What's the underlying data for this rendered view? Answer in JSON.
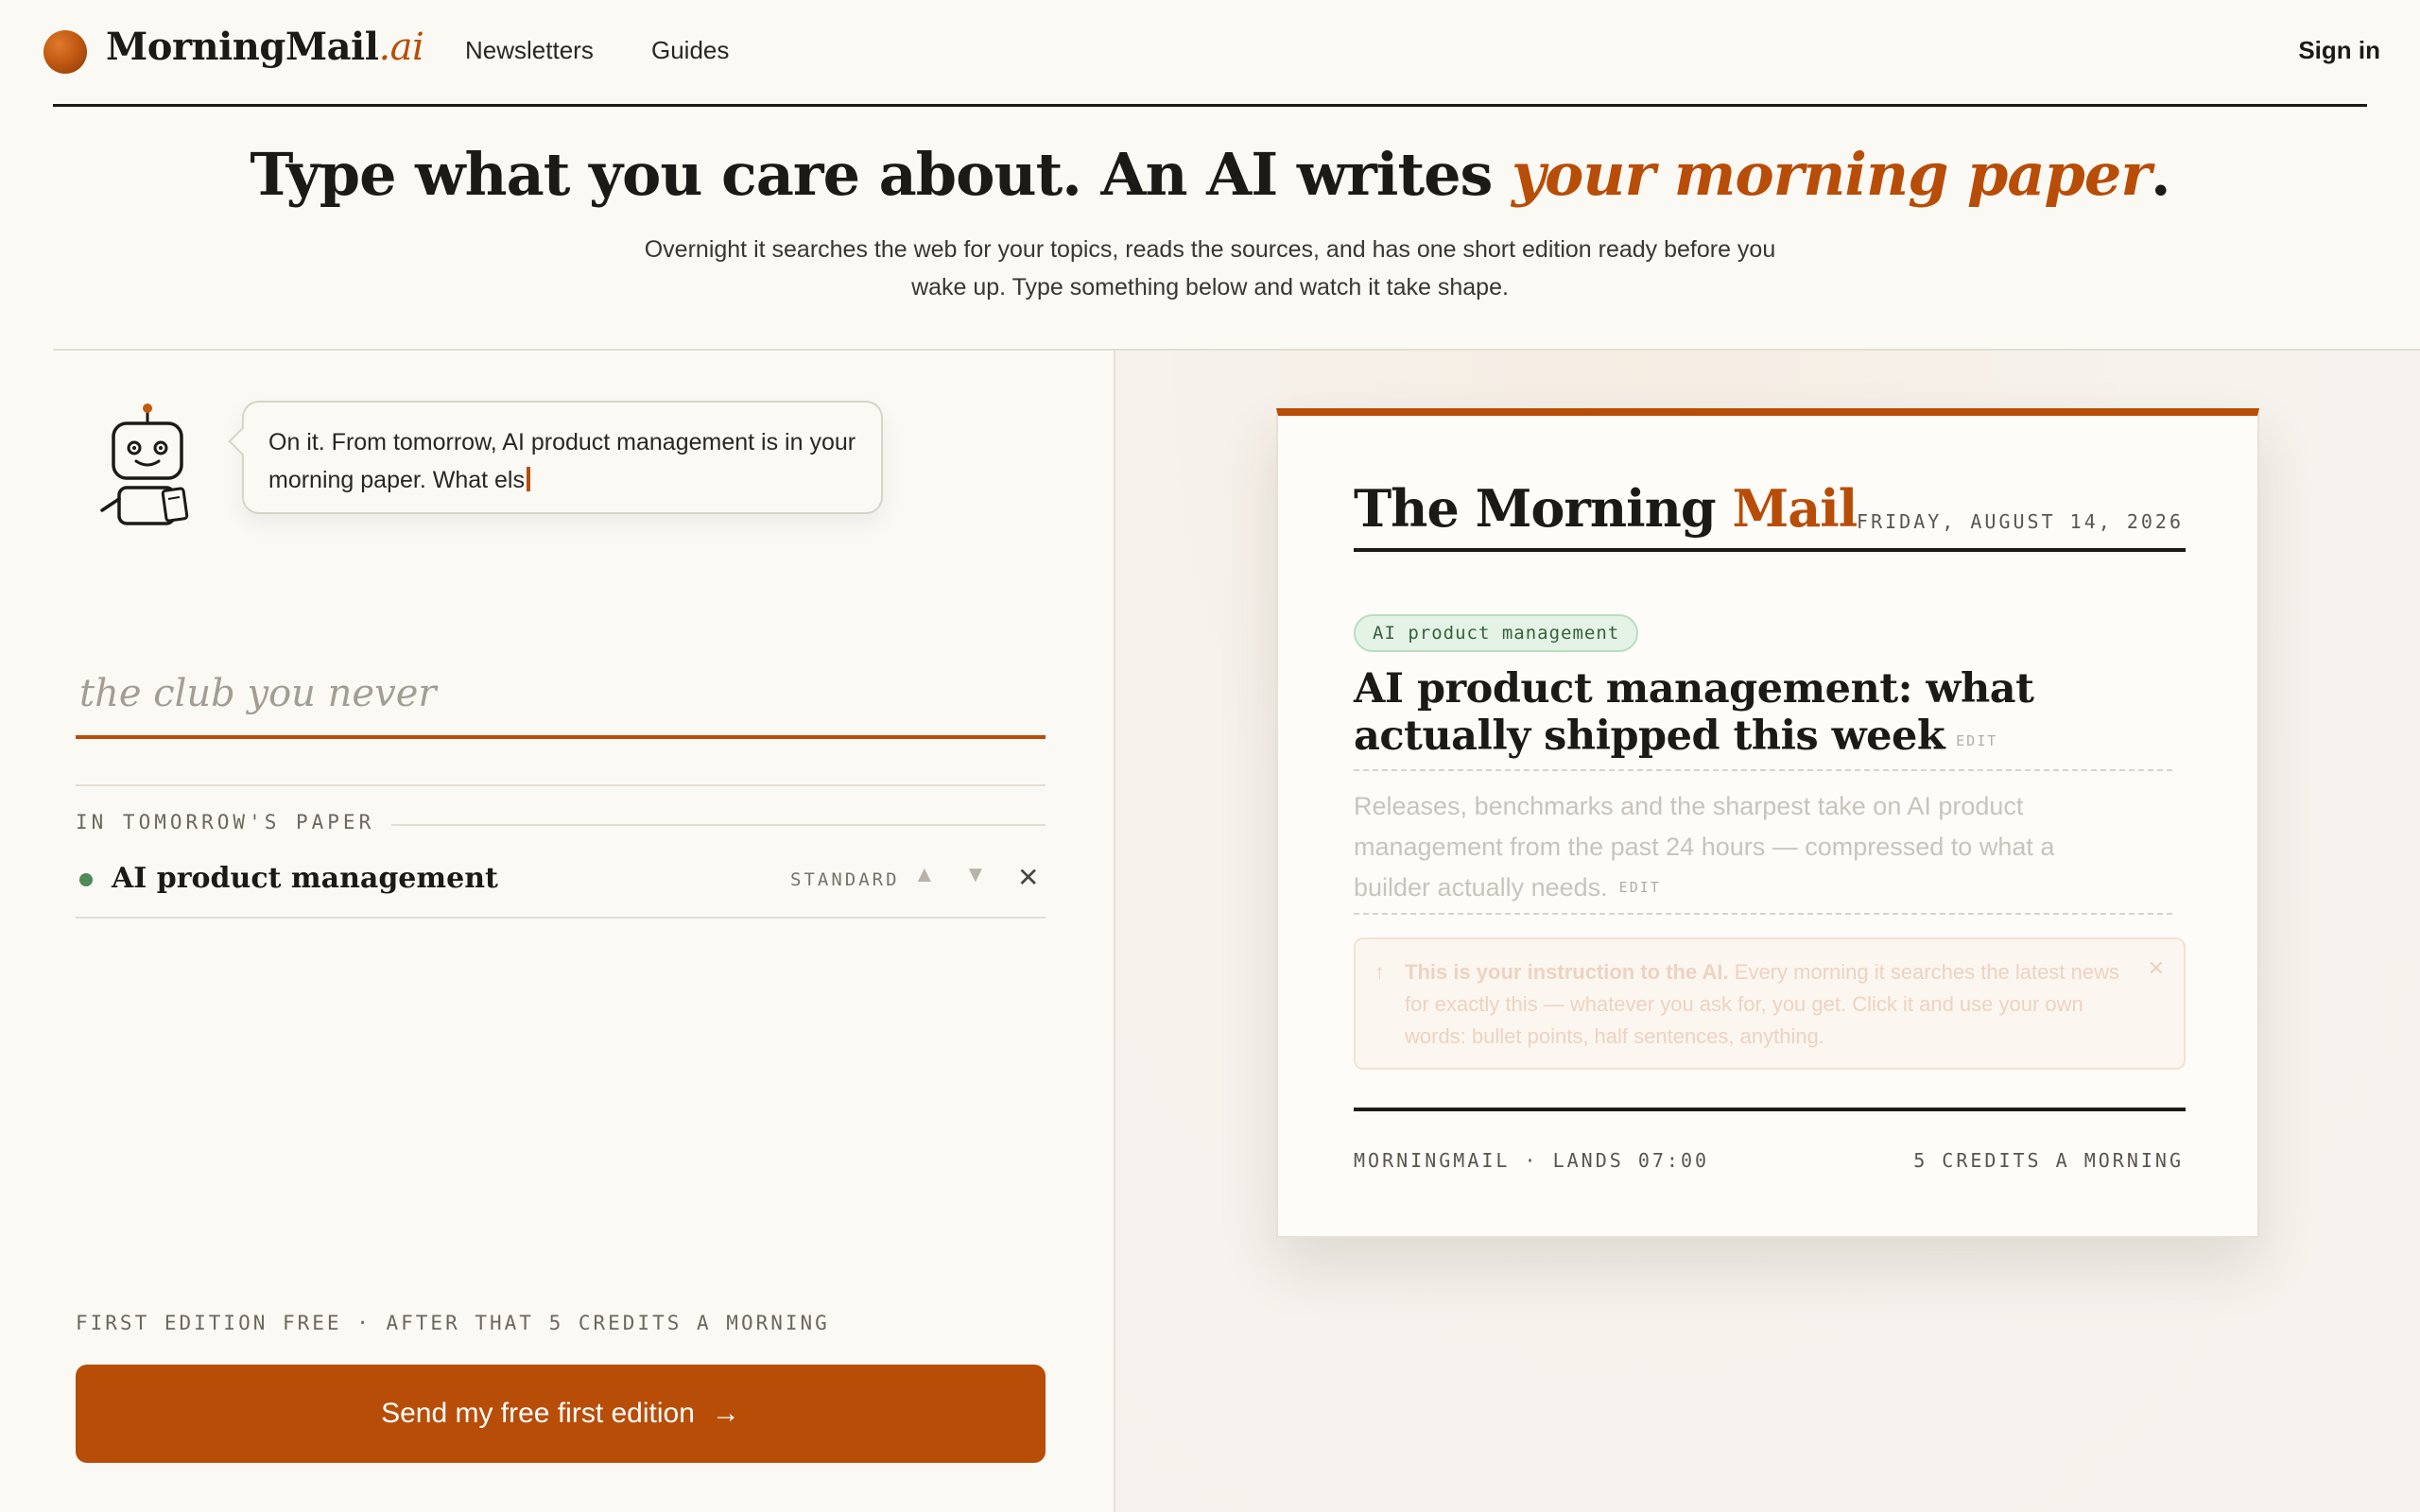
{
  "nav": {
    "brand_main": "MorningMail",
    "brand_suffix": ".ai",
    "links": [
      "Newsletters",
      "Guides"
    ],
    "sign_in": "Sign in"
  },
  "hero": {
    "title_main": "Type what you care about. An AI writes",
    "title_accent": "your morning paper",
    "title_end": ".",
    "subtitle": "Overnight it searches the web for your topics, reads the sources, and has one short edition ready before you wake up. Type something below and watch it take shape."
  },
  "assistant": {
    "message": "On it. From tomorrow, AI product management is in your morning paper. What els"
  },
  "input": {
    "placeholder": "the club you never",
    "value": ""
  },
  "topics": {
    "section_label": "IN TOMORROW'S PAPER",
    "items": [
      {
        "name": "AI product management",
        "level": "STANDARD",
        "up": "▲",
        "down": "▼",
        "remove": "✕"
      }
    ]
  },
  "footer": {
    "credits_note": "FIRST EDITION FREE · AFTER THAT 5 CREDITS A MORNING",
    "cta_label": "Send my free first edition",
    "cta_arrow": "→"
  },
  "preview": {
    "title_main": "The Morning",
    "title_accent": "Mail",
    "date": "FRIDAY, AUGUST 14, 2026",
    "topic_pill": "AI product management",
    "headline": "AI product management: what actually shipped this week",
    "edit_label": "EDIT",
    "summary": "Releases, benchmarks and the sharpest take on AI product management from the past 24 hours — compressed to what a builder actually needs.",
    "instruction_bold": "This is your instruction to the AI.",
    "instruction_rest": " Every morning it searches the latest news for exactly this — whatever you ask for, you get. Click it and use your own words: bullet points, half sentences, anything.",
    "instruction_arrow": "↑",
    "instruction_close": "✕",
    "foot_left": "MORNINGMAIL · LANDS 07:00",
    "foot_right": "5 CREDITS A MORNING"
  },
  "colors": {
    "accent": "#b84d08",
    "background": "#fbf9f4",
    "text": "#1c1a17",
    "topic_dot": "#4f8a58",
    "pill_bg": "#e5f3e6"
  },
  "icons": [
    "brand-orb-icon",
    "robot-icon",
    "arrow-right-icon",
    "close-icon",
    "arrow-up-icon",
    "arrow-down-icon"
  ]
}
